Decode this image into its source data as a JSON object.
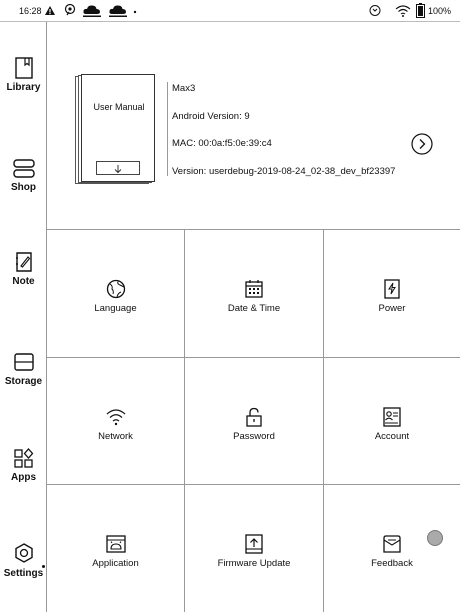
{
  "status_bar": {
    "time": "16:28",
    "battery": "100%",
    "icons": [
      "warning-icon",
      "pin-icon",
      "cloud-sync-icon",
      "cloud-sync-icon",
      "dot-icon",
      "sync-icon",
      "wifi-icon",
      "battery-icon"
    ]
  },
  "sidebar": {
    "items": [
      {
        "label": "Library",
        "icon": "library-icon"
      },
      {
        "label": "Shop",
        "icon": "shop-icon"
      },
      {
        "label": "Note",
        "icon": "note-icon"
      },
      {
        "label": "Storage",
        "icon": "storage-icon"
      },
      {
        "label": "Apps",
        "icon": "apps-icon"
      },
      {
        "label": "Settings",
        "icon": "settings-icon"
      }
    ]
  },
  "device_info": {
    "manual_title": "User Manual",
    "model": "Max3",
    "android_version": "Android Version: 9",
    "mac": "MAC: 00:0a:f5:0e:39:c4",
    "version": "Version: userdebug-2019-08-24_02-38_dev_bf23397"
  },
  "settings_grid": [
    {
      "label": "Language",
      "icon": "globe-icon"
    },
    {
      "label": "Date & Time",
      "icon": "calendar-icon"
    },
    {
      "label": "Power",
      "icon": "power-icon"
    },
    {
      "label": "Network",
      "icon": "wifi-icon"
    },
    {
      "label": "Password",
      "icon": "lock-icon"
    },
    {
      "label": "Account",
      "icon": "account-icon"
    },
    {
      "label": "Application",
      "icon": "application-icon"
    },
    {
      "label": "Firmware Update",
      "icon": "firmware-update-icon"
    },
    {
      "label": "Feedback",
      "icon": "feedback-icon"
    }
  ]
}
